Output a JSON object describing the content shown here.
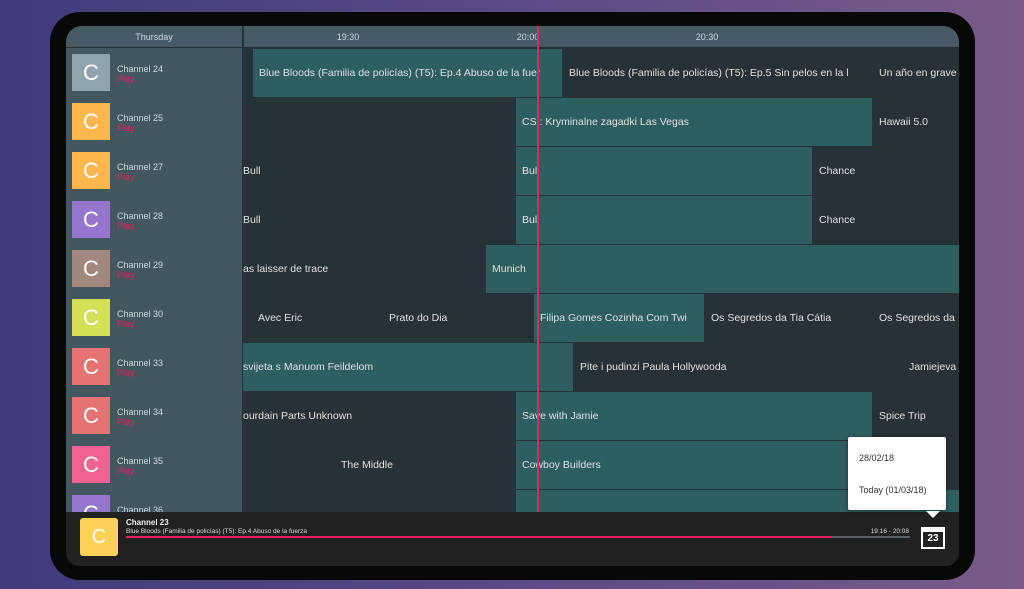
{
  "header": {
    "day": "Thursday",
    "ticks": [
      "19:30",
      "20:00",
      "20:30"
    ]
  },
  "channels": [
    {
      "name": "Channel 24",
      "action": "Play",
      "logo": "C",
      "color": "#90a4ae"
    },
    {
      "name": "Channel 25",
      "action": "Play",
      "logo": "C",
      "color": "#ffb74d"
    },
    {
      "name": "Channel 27",
      "action": "Play",
      "logo": "C",
      "color": "#ffb74d"
    },
    {
      "name": "Channel 28",
      "action": "Play",
      "logo": "C",
      "color": "#9575cd"
    },
    {
      "name": "Channel 29",
      "action": "Play",
      "logo": "C",
      "color": "#a1887f"
    },
    {
      "name": "Channel 30",
      "action": "Play",
      "logo": "C",
      "color": "#d4e157"
    },
    {
      "name": "Channel 33",
      "action": "Play",
      "logo": "C",
      "color": "#e57373"
    },
    {
      "name": "Channel 34",
      "action": "Play",
      "logo": "C",
      "color": "#e57373"
    },
    {
      "name": "Channel 35",
      "action": "Play",
      "logo": "C",
      "color": "#f06292"
    },
    {
      "name": "Channel 36",
      "action": "Play",
      "logo": "C",
      "color": "#9575cd"
    }
  ],
  "rows": [
    [
      {
        "t": "",
        "on": false
      },
      {
        "t": "Blue Bloods (Familia de policías) (T5): Ep.4 Abuso de la fuer",
        "on": true
      },
      {
        "t": "Blue Bloods (Familia de policías) (T5): Ep.5 Sin pelos en la l",
        "on": false
      },
      {
        "t": "Un año en grave",
        "on": false
      }
    ],
    [
      {
        "t": "",
        "on": false
      },
      {
        "t": "CS : Kryminalne zagadki Las Vegas",
        "on": true
      },
      {
        "t": "Hawaii 5.0",
        "on": false
      }
    ],
    [
      {
        "t": "Bull",
        "on": false
      },
      {
        "t": "Bull",
        "on": true
      },
      {
        "t": "Chance",
        "on": false
      }
    ],
    [
      {
        "t": "Bull",
        "on": false
      },
      {
        "t": "Bull",
        "on": true
      },
      {
        "t": "Chance",
        "on": false
      }
    ],
    [
      {
        "t": "as laisser de trace",
        "on": false
      },
      {
        "t": "Munich",
        "on": true
      }
    ],
    [
      {
        "t": "",
        "on": false
      },
      {
        "t": "Avec Eric",
        "on": false
      },
      {
        "t": "Prato do Dia",
        "on": false
      },
      {
        "t": "Filipa Gomes Cozinha Com Twi",
        "on": true
      },
      {
        "t": "Os Segredos da Tia Cátia",
        "on": false
      },
      {
        "t": "Os Segredos da",
        "on": false
      }
    ],
    [
      {
        "t": "svijeta s Manuom Feildelom",
        "on": true
      },
      {
        "t": "Pite i pudinzi Paula Hollywooda",
        "on": false
      },
      {
        "t": "Jamiejeva",
        "on": false
      }
    ],
    [
      {
        "t": "ourdain Parts Unknown",
        "on": false
      },
      {
        "t": "Save with Jamie",
        "on": true
      },
      {
        "t": "Spice Trip",
        "on": false
      }
    ],
    [
      {
        "t": "",
        "on": false
      },
      {
        "t": "The Middle",
        "on": false
      },
      {
        "t": "",
        "on": false
      },
      {
        "t": "Cowboy Builders",
        "on": true
      },
      {
        "t": "e F",
        "on": false
      }
    ],
    [
      {
        "t": "",
        "on": false
      },
      {
        "t": "",
        "on": false
      },
      {
        "t": "",
        "on": true
      }
    ]
  ],
  "now_playing": {
    "channel": "Channel 23",
    "logo": "C",
    "title": "Blue Bloods (Familia de policías) (T5): Ep.4 Abuso de la fuerza",
    "time": "19:16 - 20:08",
    "progress": 0.9
  },
  "calendar": {
    "icon": "calendar-icon",
    "day": "23"
  },
  "date_menu": {
    "options": [
      "28/02/18",
      "Today (01/03/18)"
    ]
  },
  "colors": {
    "accent": "#e91e63",
    "current_program": "#2d5e60",
    "program": "#263238"
  }
}
